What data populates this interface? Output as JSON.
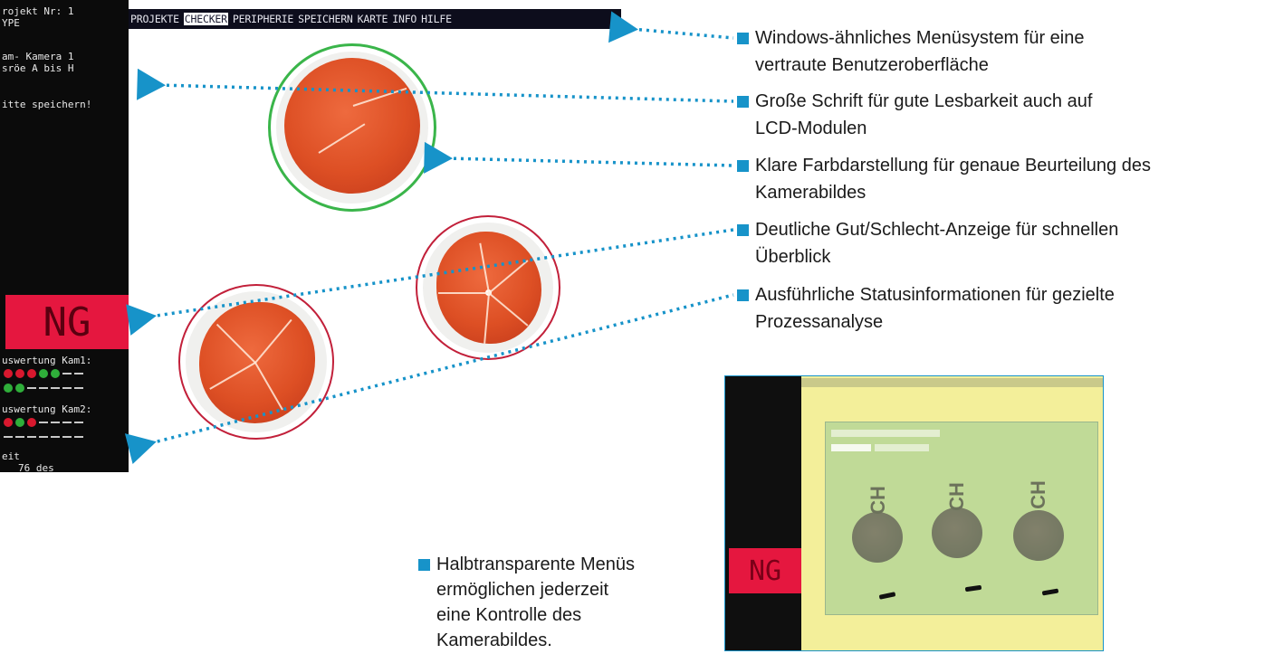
{
  "screen": {
    "left_panel": {
      "lines": [
        "rojekt Nr: 1",
        "YPE",
        "",
        "am- Kamera 1",
        "sröe A bis H",
        "",
        "itte speichern!"
      ],
      "ng_label": "NG",
      "eval_cam1": "uswertung Kam1:",
      "eval_cam2": "uswertung Kam2:",
      "time_label": "eit",
      "time_value": "76 des"
    },
    "menu": {
      "items": [
        "PROJEKTE",
        "CHECKER",
        "PERIPHERIE",
        "SPEICHERN",
        "KARTE",
        "INFO",
        "HILFE"
      ],
      "active_index": 1
    },
    "status_colors": {
      "ok": "#2fae3a",
      "ng": "#d8182e"
    },
    "dot_rows": {
      "cam1_row1": [
        "red",
        "red",
        "red",
        "green",
        "green",
        "dash",
        "dash"
      ],
      "cam1_row2": [
        "green",
        "green",
        "dash",
        "dash",
        "dash",
        "dash",
        "dash"
      ],
      "cam2_row1": [
        "red",
        "green",
        "red",
        "dash",
        "dash",
        "dash",
        "dash"
      ],
      "cam2_row2": [
        "dash",
        "dash",
        "dash",
        "dash",
        "dash",
        "dash",
        "dash"
      ]
    }
  },
  "callouts": [
    {
      "line1": "Windows-ähnliches Menüsystem für eine",
      "line2": "vertraute Benutzeroberfläche"
    },
    {
      "line1": "Große Schrift für gute Lesbarkeit auch auf",
      "line2": "LCD-Modulen"
    },
    {
      "line1": "Klare Farbdarstellung für genaue Beurteilung des",
      "line2": "Kamerabildes"
    },
    {
      "line1": "Deutliche Gut/Schlecht-Anzeige für schnellen",
      "line2": "Überblick"
    },
    {
      "line1": "Ausführliche Statusinformationen für gezielte",
      "line2": "Prozessanalyse"
    }
  ],
  "bottom_note": {
    "lines": [
      "Halbtransparente Menüs",
      "ermöglichen jederzeit",
      "eine Kontrolle des",
      "Kamerabildes."
    ]
  },
  "mini_screen": {
    "ng_label": "NG",
    "can_text": "CH"
  },
  "accent_color": "#1793c9"
}
